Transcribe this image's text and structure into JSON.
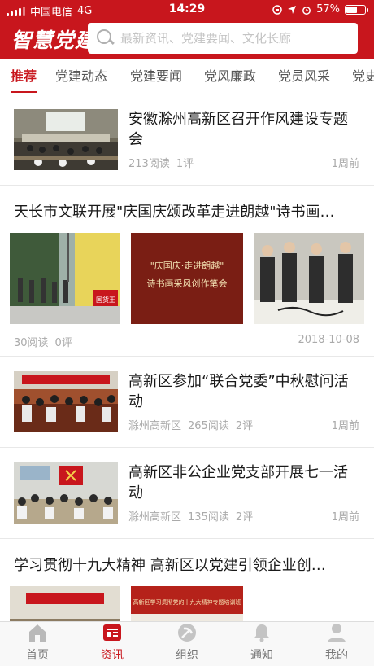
{
  "status_bar": {
    "carrier": "中国电信",
    "network": "4G",
    "time": "14:29",
    "battery": "57%",
    "battery_level": 0.57
  },
  "header": {
    "logo": "智慧党建",
    "search_placeholder": "最新资讯、党建要闻、文化长廊"
  },
  "tabs": [
    "推荐",
    "党建动态",
    "党建要闻",
    "党风廉政",
    "党员风采",
    "党史"
  ],
  "active_tab": 0,
  "articles": [
    {
      "title": "安徽滁州高新区召开作风建设专题会",
      "source": "",
      "reads": "213阅读",
      "comments": "1评",
      "time": "1周前"
    },
    {
      "title": "天长市文联开展\"庆国庆颂改革走进朗越\"诗书画…",
      "reads": "30阅读",
      "comments": "0评",
      "time": "2018-10-08",
      "banner_text_1": "\"庆国庆·走进朗越\"",
      "banner_text_2": "诗书画采风创作笔会",
      "sign_text": "国货王"
    },
    {
      "title": "高新区参加“联合党委”中秋慰问活动",
      "source": "滁州高新区",
      "reads": "265阅读",
      "comments": "2评",
      "time": "1周前"
    },
    {
      "title": "高新区非公企业党支部开展七一活动",
      "source": "滁州高新区",
      "reads": "135阅读",
      "comments": "2评",
      "time": "1周前"
    },
    {
      "title": "学习贯彻十九大精神 高新区以党建引领企业创…",
      "banner_text_2": "高新区学习贯彻党的十九大精神专题培训班"
    }
  ],
  "tabbar": [
    {
      "label": "首页",
      "icon": "home-icon"
    },
    {
      "label": "资讯",
      "icon": "news-icon"
    },
    {
      "label": "组织",
      "icon": "party-emblem-icon"
    },
    {
      "label": "通知",
      "icon": "bell-icon"
    },
    {
      "label": "我的",
      "icon": "user-icon"
    }
  ],
  "active_tabbar": 1,
  "colors": {
    "brand": "#c8161d",
    "muted": "#aaaaaa"
  }
}
